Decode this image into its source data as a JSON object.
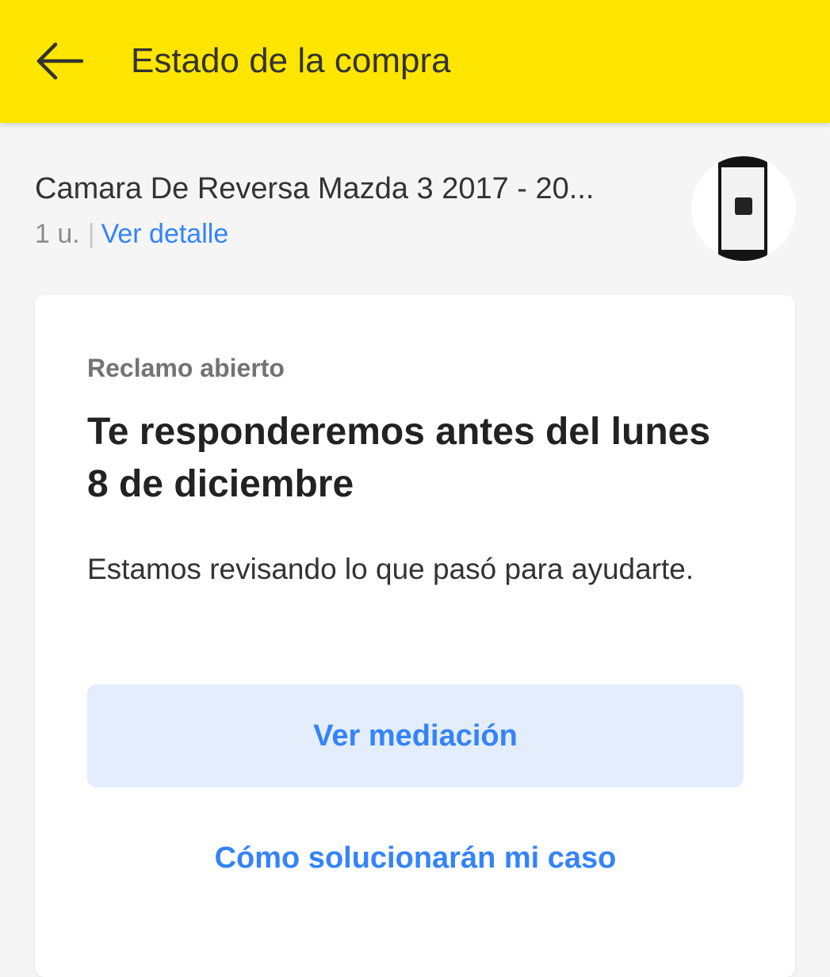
{
  "header": {
    "back_icon": "arrow-left-icon",
    "title": "Estado de la compra",
    "background_color": "#ffe600"
  },
  "product": {
    "title": "Camara De Reversa Mazda 3 2017 - 20...",
    "quantity": "1 u.",
    "separator": "|",
    "detail_link": "Ver detalle",
    "thumbnail_icon": "product-thumbnail"
  },
  "claim": {
    "status": "Reclamo abierto",
    "heading": "Te responderemos antes del lunes 8 de diciembre",
    "description": "Estamos revisando lo que pasó para ayudarte.",
    "primary_button": "Ver mediación",
    "secondary_link": "Cómo solucionarán mi caso"
  },
  "colors": {
    "accent": "#3483fa",
    "button_bg": "#e3edfb",
    "page_bg": "#f5f5f5"
  }
}
